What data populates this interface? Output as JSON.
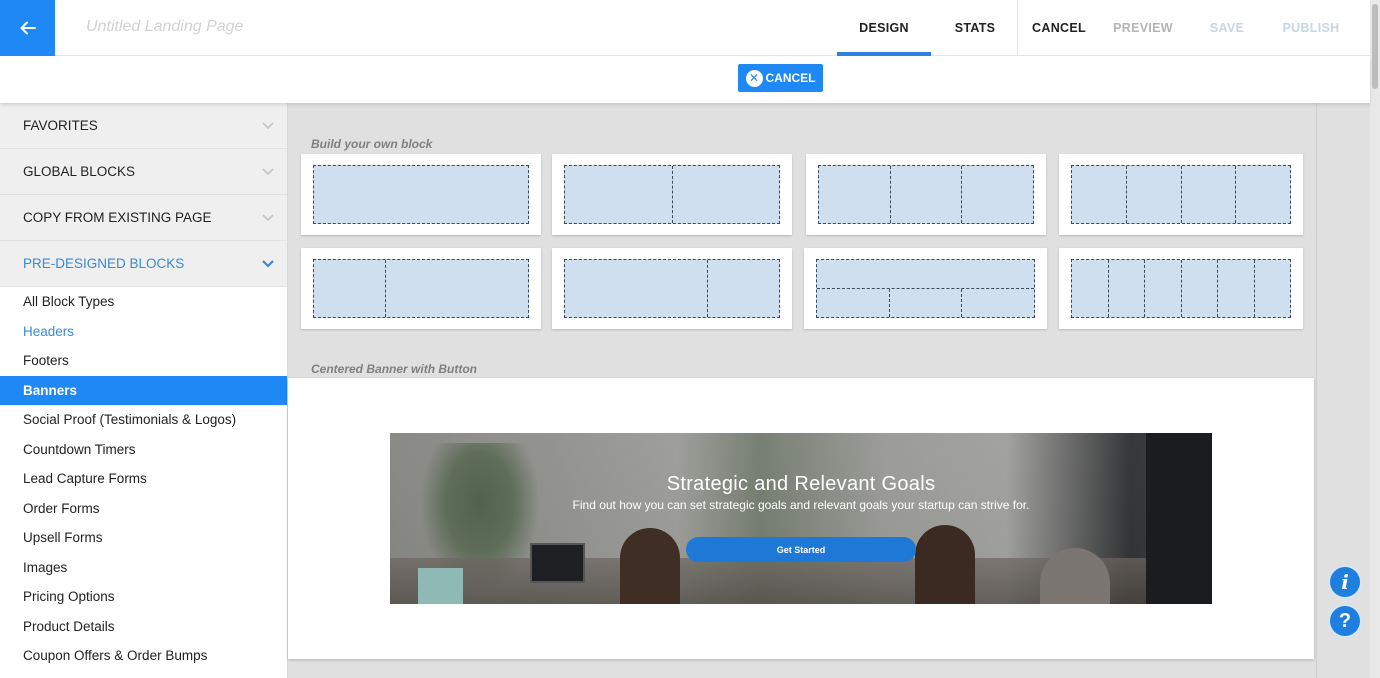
{
  "header": {
    "page_title": "Untitled Landing Page",
    "tabs": [
      {
        "label": "DESIGN",
        "active": true
      },
      {
        "label": "STATS",
        "active": false
      }
    ],
    "actions": {
      "cancel": "CANCEL",
      "preview": "PREVIEW",
      "save": "SAVE",
      "publish": "PUBLISH"
    },
    "icons": {
      "back": "arrow-left-icon"
    }
  },
  "subbar": {
    "cancel_label": "CANCEL",
    "cancel_icon": "close-circle-icon"
  },
  "sidebar": {
    "sections": [
      {
        "label": "FAVORITES",
        "expanded": false
      },
      {
        "label": "GLOBAL BLOCKS",
        "expanded": false
      },
      {
        "label": "COPY FROM EXISTING PAGE",
        "expanded": false
      },
      {
        "label": "PRE-DESIGNED BLOCKS",
        "expanded": true
      }
    ],
    "items": [
      {
        "label": "All Block Types",
        "state": "normal"
      },
      {
        "label": "Headers",
        "state": "hover"
      },
      {
        "label": "Footers",
        "state": "normal"
      },
      {
        "label": "Banners",
        "state": "selected"
      },
      {
        "label": "Social Proof (Testimonials & Logos)",
        "state": "normal"
      },
      {
        "label": "Countdown Timers",
        "state": "normal"
      },
      {
        "label": "Lead Capture Forms",
        "state": "normal"
      },
      {
        "label": "Order Forms",
        "state": "normal"
      },
      {
        "label": "Upsell Forms",
        "state": "normal"
      },
      {
        "label": "Images",
        "state": "normal"
      },
      {
        "label": "Pricing Options",
        "state": "normal"
      },
      {
        "label": "Product Details",
        "state": "normal"
      },
      {
        "label": "Coupon Offers & Order Bumps",
        "state": "normal"
      }
    ]
  },
  "main": {
    "build_label": "Build your own block",
    "layouts": [
      {
        "name": "1-column",
        "columns": [
          1
        ]
      },
      {
        "name": "2-columns",
        "columns": [
          1,
          1
        ]
      },
      {
        "name": "3-columns",
        "columns": [
          1,
          1,
          1
        ]
      },
      {
        "name": "4-columns",
        "columns": [
          1,
          1,
          1,
          1
        ]
      },
      {
        "name": "1-3-split",
        "columns": [
          1,
          2
        ]
      },
      {
        "name": "2-1-split",
        "columns": [
          2,
          1
        ]
      },
      {
        "name": "1-over-3",
        "columns": [
          1,
          1,
          1
        ],
        "stacked": true
      },
      {
        "name": "6-columns",
        "columns": [
          1,
          1,
          1,
          1,
          1,
          1
        ]
      }
    ],
    "preview_label": "Centered Banner with Button",
    "banner": {
      "title": "Strategic and Relevant Goals",
      "subtitle": "Find out how you can set strategic goals and relevant goals your startup can strive for.",
      "button_label": "Get Started"
    }
  },
  "fabs": {
    "info_glyph": "i",
    "help_glyph": "?"
  },
  "colors": {
    "accent": "#1e88f5",
    "active_tab_underline": "#2f80dd",
    "section_active_text": "#3a8ad6",
    "layout_fill": "#d0dff0"
  }
}
